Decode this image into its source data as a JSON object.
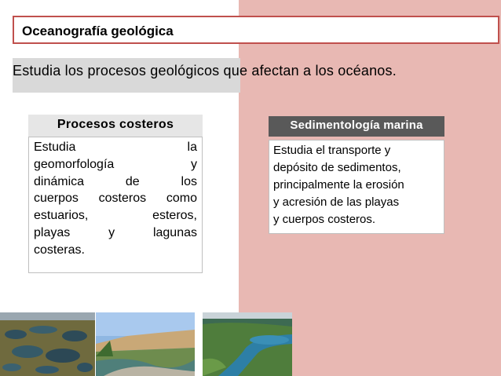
{
  "slide": {
    "title": "Oceanografía geológica",
    "subtitle": "Estudia los procesos geológicos que afectan a los océanos."
  },
  "left_box": {
    "title": "Procesos costeros",
    "lines": [
      [
        "Estudia",
        "la"
      ],
      [
        "geomorfología",
        "y"
      ],
      [
        "dinámica",
        "de",
        "los"
      ],
      [
        "cuerpos",
        "costeros",
        "como"
      ],
      [
        "estuarios,",
        "esteros,"
      ],
      [
        "playas",
        "y",
        "lagunas"
      ]
    ],
    "last_line": "costeras."
  },
  "right_box": {
    "title": "Sedimentología marina",
    "lines": [
      "Estudia el transporte y",
      "depósito de sedimentos,",
      "principalmente la erosión",
      "y acresión de las playas",
      "y cuerpos costeros."
    ]
  },
  "colors": {
    "accent_border": "#c0504d",
    "pink_panel": "#e8b8b3",
    "dark_header": "#595959"
  },
  "images": [
    "lagoons-aerial-photo",
    "coastal-beach-photo",
    "estuary-aerial-photo"
  ]
}
